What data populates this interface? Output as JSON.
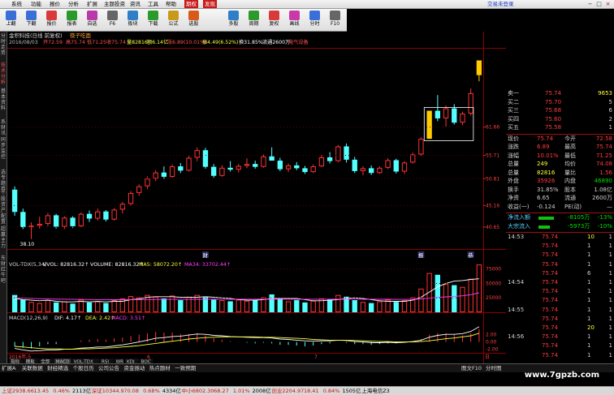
{
  "menubar": {
    "items": [
      "系统",
      "功能",
      "报价",
      "分析",
      "扩展",
      "主题投资",
      "资讯",
      "工具",
      "帮助"
    ],
    "highlight_items": [
      "期权",
      "发现"
    ],
    "login": "交易未登录"
  },
  "toolbar": {
    "buttons": [
      {
        "label": "上翻",
        "icon": "page-up-icon",
        "color": "#3a6fd8"
      },
      {
        "label": "下翻",
        "icon": "page-down-icon",
        "color": "#3a6fd8"
      },
      {
        "label": "报价",
        "icon": "quote-icon",
        "color": "#d83a3a"
      },
      {
        "label": "报表",
        "icon": "report-icon",
        "color": "#2a9a2a"
      },
      {
        "label": "自选",
        "icon": "watchlist-icon",
        "color": "#b83aa8"
      },
      {
        "label": "F6",
        "icon": "f6-icon",
        "color": "#666"
      },
      {
        "label": "板块",
        "icon": "sector-icon",
        "color": "#2f7fc8"
      },
      {
        "label": "下载",
        "icon": "download-icon",
        "color": "#2a9a2a"
      },
      {
        "label": "公式",
        "icon": "formula-icon",
        "color": "#c89a1a"
      },
      {
        "label": "选股",
        "icon": "stock-screen-icon",
        "color": "#d85a1a"
      },
      {
        "label": "多股",
        "icon": "multi-stock-icon",
        "color": "#2f7fc8"
      },
      {
        "label": "周期",
        "icon": "period-icon",
        "color": "#2a9a2a"
      },
      {
        "label": "复权",
        "icon": "adjust-icon",
        "color": "#d83a3a"
      },
      {
        "label": "画线",
        "icon": "draw-line-icon",
        "color": "#c83aa8"
      },
      {
        "label": "分时",
        "icon": "intraday-icon",
        "color": "#3a6fd8"
      },
      {
        "label": "F10",
        "icon": "f10-icon",
        "color": "#666"
      }
    ]
  },
  "left_tabs": [
    "分时走势",
    "技术分析",
    "基本资料",
    "系财讯",
    "同步监控",
    "选专题券",
    "个股资产配置",
    "超赢主力",
    "东财红牛吧"
  ],
  "chart_header": {
    "title": "金积科技(日线 前复权)",
    "pattern": "筷子吃面",
    "date": "2016/08/03",
    "open": "开72.59",
    "high": "高75.74",
    "low": "低71.25",
    "close": "收75.74",
    "volume": "量82816",
    "amount": "额6.14亿",
    "change": "涨6.89(10.01%)",
    "amplitude": "振4.49(6.52%)",
    "turnover": "换31.85%",
    "float": "流通2600万",
    "industry": "电气设备"
  },
  "chart_data": [
    {
      "type": "candlestick",
      "price_axis_ticks": [
        "61.66",
        "55.71",
        "50.81",
        "45.16",
        "40.65"
      ],
      "ylim": [
        36.0,
        78.0
      ],
      "low_marker": "38.10",
      "event_markers": [
        "财",
        "报",
        "恭"
      ],
      "candles": [
        {
          "o": 48.5,
          "h": 49.2,
          "l": 43.0,
          "c": 43.8
        },
        {
          "o": 43.8,
          "h": 44.5,
          "l": 40.2,
          "c": 40.6
        },
        {
          "o": 40.6,
          "h": 41.6,
          "l": 38.1,
          "c": 40.9
        },
        {
          "o": 40.9,
          "h": 42.8,
          "l": 40.3,
          "c": 41.3
        },
        {
          "o": 41.3,
          "h": 43.6,
          "l": 40.8,
          "c": 43.1
        },
        {
          "o": 43.1,
          "h": 43.4,
          "l": 40.3,
          "c": 40.7
        },
        {
          "o": 40.7,
          "h": 42.9,
          "l": 40.2,
          "c": 42.6
        },
        {
          "o": 42.6,
          "h": 42.9,
          "l": 40.4,
          "c": 40.8
        },
        {
          "o": 40.8,
          "h": 43.7,
          "l": 40.6,
          "c": 43.4
        },
        {
          "o": 43.4,
          "h": 44.1,
          "l": 41.7,
          "c": 42.4
        },
        {
          "o": 42.4,
          "h": 44.5,
          "l": 42.0,
          "c": 43.9
        },
        {
          "o": 43.9,
          "h": 44.2,
          "l": 41.8,
          "c": 42.2
        },
        {
          "o": 42.2,
          "h": 44.6,
          "l": 42.0,
          "c": 44.3
        },
        {
          "o": 44.3,
          "h": 45.9,
          "l": 43.5,
          "c": 45.5
        },
        {
          "o": 45.5,
          "h": 48.2,
          "l": 45.1,
          "c": 47.8
        },
        {
          "o": 47.8,
          "h": 49.6,
          "l": 47.2,
          "c": 49.2
        },
        {
          "o": 49.2,
          "h": 51.3,
          "l": 48.6,
          "c": 50.8
        },
        {
          "o": 50.8,
          "h": 52.6,
          "l": 50.3,
          "c": 52.1
        },
        {
          "o": 52.1,
          "h": 53.4,
          "l": 50.7,
          "c": 51.2
        },
        {
          "o": 51.2,
          "h": 53.8,
          "l": 51.0,
          "c": 53.4
        },
        {
          "o": 53.4,
          "h": 54.1,
          "l": 52.0,
          "c": 52.5
        },
        {
          "o": 52.5,
          "h": 55.6,
          "l": 52.3,
          "c": 55.2
        },
        {
          "o": 55.2,
          "h": 57.4,
          "l": 54.5,
          "c": 56.8
        },
        {
          "o": 56.8,
          "h": 57.3,
          "l": 52.9,
          "c": 53.3
        },
        {
          "o": 53.3,
          "h": 53.9,
          "l": 51.0,
          "c": 51.4
        },
        {
          "o": 51.4,
          "h": 53.6,
          "l": 51.2,
          "c": 53.1
        },
        {
          "o": 53.1,
          "h": 54.5,
          "l": 52.3,
          "c": 52.7
        },
        {
          "o": 52.7,
          "h": 53.9,
          "l": 52.1,
          "c": 53.5
        },
        {
          "o": 53.5,
          "h": 55.1,
          "l": 53.0,
          "c": 53.9
        },
        {
          "o": 53.9,
          "h": 54.6,
          "l": 52.9,
          "c": 53.3
        },
        {
          "o": 53.3,
          "h": 55.9,
          "l": 53.1,
          "c": 55.5
        },
        {
          "o": 55.5,
          "h": 57.4,
          "l": 54.8,
          "c": 54.6
        },
        {
          "o": 54.6,
          "h": 55.2,
          "l": 52.4,
          "c": 52.8
        },
        {
          "o": 52.8,
          "h": 54.0,
          "l": 52.2,
          "c": 53.6
        },
        {
          "o": 53.6,
          "h": 54.3,
          "l": 52.6,
          "c": 53.0
        },
        {
          "o": 53.0,
          "h": 53.5,
          "l": 51.8,
          "c": 52.2
        },
        {
          "o": 52.2,
          "h": 53.8,
          "l": 52.0,
          "c": 53.4
        },
        {
          "o": 53.4,
          "h": 55.8,
          "l": 53.2,
          "c": 55.3
        },
        {
          "o": 55.3,
          "h": 56.4,
          "l": 54.0,
          "c": 54.5
        },
        {
          "o": 54.5,
          "h": 57.9,
          "l": 54.3,
          "c": 57.6
        },
        {
          "o": 57.6,
          "h": 58.2,
          "l": 54.2,
          "c": 54.8
        },
        {
          "o": 54.8,
          "h": 55.4,
          "l": 52.0,
          "c": 52.4
        },
        {
          "o": 52.4,
          "h": 53.4,
          "l": 51.5,
          "c": 53.0
        },
        {
          "o": 53.0,
          "h": 53.6,
          "l": 51.6,
          "c": 52.0
        },
        {
          "o": 52.0,
          "h": 53.4,
          "l": 51.8,
          "c": 53.1
        },
        {
          "o": 53.1,
          "h": 55.1,
          "l": 52.8,
          "c": 54.7
        },
        {
          "o": 54.7,
          "h": 55.0,
          "l": 51.9,
          "c": 52.3
        },
        {
          "o": 52.3,
          "h": 54.5,
          "l": 51.8,
          "c": 54.2
        },
        {
          "o": 54.2,
          "h": 56.3,
          "l": 54.0,
          "c": 55.9
        },
        {
          "o": 55.9,
          "h": 59.5,
          "l": 55.6,
          "c": 59.2
        },
        {
          "o": 59.2,
          "h": 65.1,
          "l": 59.2,
          "c": 65.1
        },
        {
          "o": 65.1,
          "h": 68.4,
          "l": 62.9,
          "c": 63.5
        },
        {
          "o": 63.5,
          "h": 66.2,
          "l": 61.8,
          "c": 65.6
        },
        {
          "o": 65.6,
          "h": 66.5,
          "l": 62.2,
          "c": 62.6
        },
        {
          "o": 62.6,
          "h": 64.9,
          "l": 62.1,
          "c": 64.5
        },
        {
          "o": 64.5,
          "h": 69.8,
          "l": 64.1,
          "c": 68.8
        },
        {
          "o": 72.6,
          "h": 75.7,
          "l": 71.3,
          "c": 75.7
        }
      ]
    },
    {
      "type": "bar",
      "name": "VOL-TDX(5,34)",
      "legend": [
        "VOL-TDX(5,34)",
        "VVOL: 82816.32↑",
        "VOLUME: 82816.32↑",
        "MA5: 58072.20↑",
        "MA34: 33702.44↑"
      ],
      "axis_ticks": [
        "75000",
        "50000",
        "25000"
      ],
      "ylim": [
        0,
        90000
      ],
      "values": [
        30000,
        22000,
        18000,
        16000,
        21000,
        17000,
        19000,
        15000,
        22000,
        17000,
        19000,
        16000,
        21000,
        24000,
        28000,
        26000,
        30000,
        27000,
        24000,
        29000,
        21000,
        27000,
        30000,
        26000,
        22000,
        21000,
        19000,
        22000,
        20000,
        21000,
        26000,
        31000,
        24000,
        19000,
        21000,
        17000,
        20000,
        24000,
        22000,
        30000,
        27000,
        21000,
        18000,
        16000,
        19000,
        22000,
        18000,
        21000,
        26000,
        41000,
        68000,
        65000,
        49000,
        47000,
        44000,
        58000,
        82816
      ],
      "ma5": [
        24000,
        22000,
        21000,
        20000,
        21000,
        19000,
        18000,
        18000,
        19000,
        18000,
        19000,
        18000,
        19000,
        19000,
        22000,
        23000,
        26000,
        27000,
        27000,
        27000,
        26000,
        26000,
        26000,
        27000,
        26000,
        25000,
        24000,
        22000,
        21000,
        21000,
        22000,
        24000,
        24000,
        24000,
        24000,
        22000,
        20000,
        20000,
        21000,
        22000,
        24000,
        25000,
        24000,
        22000,
        20000,
        19000,
        19000,
        19000,
        21000,
        26000,
        35000,
        44000,
        50000,
        54000,
        55000,
        57000,
        58072
      ],
      "ma34": [
        25000,
        24500,
        24000,
        23500,
        23000,
        22800,
        22600,
        22400,
        22300,
        22100,
        22000,
        21900,
        21800,
        21800,
        21900,
        22000,
        22100,
        22200,
        22300,
        22300,
        22300,
        22400,
        22500,
        22600,
        22600,
        22600,
        22600,
        22600,
        22600,
        22600,
        22700,
        22800,
        22800,
        22800,
        22700,
        22600,
        22600,
        22600,
        22600,
        22700,
        22800,
        22800,
        22700,
        22600,
        22500,
        22500,
        22400,
        22400,
        22500,
        23200,
        24500,
        25800,
        26700,
        27500,
        28500,
        30500,
        33702
      ]
    },
    {
      "type": "line",
      "name": "MACD(12,26,9)",
      "legend": [
        "MACD(12,26,9)",
        "DIF: 4.17↑",
        "DEA: 2.42↑",
        "MACD: 3.51↑"
      ],
      "axis_ticks": [
        "2.00",
        "0.00",
        "-2.00"
      ],
      "ylim": [
        -3.0,
        5.5
      ],
      "dif": [
        -1.8,
        -2.2,
        -2.5,
        -2.4,
        -2.2,
        -2.2,
        -2.0,
        -2.0,
        -1.7,
        -1.6,
        -1.4,
        -1.4,
        -1.1,
        -0.8,
        -0.4,
        0.0,
        0.5,
        1.0,
        1.2,
        1.5,
        1.6,
        1.9,
        2.2,
        2.1,
        1.8,
        1.7,
        1.5,
        1.4,
        1.3,
        1.2,
        1.2,
        1.1,
        0.8,
        0.7,
        0.5,
        0.3,
        0.2,
        0.3,
        0.3,
        0.5,
        0.4,
        0.1,
        0.0,
        -0.2,
        -0.2,
        -0.1,
        -0.2,
        -0.1,
        0.1,
        0.5,
        1.3,
        1.8,
        2.1,
        2.1,
        2.3,
        2.9,
        4.17
      ],
      "dea": [
        -1.2,
        -1.4,
        -1.6,
        -1.8,
        -1.9,
        -1.9,
        -2.0,
        -2.0,
        -1.9,
        -1.9,
        -1.8,
        -1.7,
        -1.6,
        -1.4,
        -1.2,
        -1.0,
        -0.7,
        -0.4,
        -0.1,
        0.2,
        0.5,
        0.8,
        1.0,
        1.2,
        1.3,
        1.4,
        1.4,
        1.4,
        1.4,
        1.4,
        1.3,
        1.3,
        1.2,
        1.1,
        1.0,
        0.9,
        0.7,
        0.6,
        0.5,
        0.5,
        0.5,
        0.4,
        0.3,
        0.2,
        0.1,
        0.1,
        0.0,
        0.0,
        0.0,
        0.1,
        0.3,
        0.6,
        0.9,
        1.1,
        1.4,
        1.7,
        2.42
      ],
      "hist": [
        -1.2,
        -1.6,
        -1.8,
        -1.2,
        -0.6,
        -0.6,
        0.0,
        0.0,
        0.4,
        0.6,
        0.8,
        0.6,
        1.0,
        1.2,
        1.6,
        2.0,
        2.4,
        2.8,
        2.6,
        2.6,
        2.2,
        2.2,
        2.4,
        1.8,
        1.0,
        0.6,
        0.2,
        0.0,
        -0.2,
        -0.4,
        -0.2,
        -0.4,
        -0.8,
        -0.8,
        -1.0,
        -1.2,
        -1.0,
        -0.6,
        -0.4,
        0.0,
        -0.2,
        -0.6,
        -0.6,
        -0.8,
        -0.6,
        -0.4,
        -0.4,
        -0.2,
        0.2,
        0.8,
        2.0,
        2.4,
        2.4,
        2.0,
        1.8,
        2.4,
        3.51
      ]
    }
  ],
  "x_axis_labels": [
    "2016年-5",
    "6",
    "7",
    "日"
  ],
  "indicator_tabs": [
    "指标",
    "模板",
    "全部",
    "MACD",
    "VOL-TDX",
    "RSI",
    "WR",
    "KDJ",
    "BOC"
  ],
  "quote_panel": {
    "sell_book": [
      {
        "label": "卖一",
        "price": "75.74",
        "vol": "9653"
      },
      {
        "label": "买二",
        "price": "75.70",
        "vol": "5"
      },
      {
        "label": "买三",
        "price": "75.68",
        "vol": "6"
      },
      {
        "label": "买四",
        "price": "75.60",
        "vol": "2"
      },
      {
        "label": "买五",
        "price": "75.58",
        "vol": "1"
      }
    ],
    "stats": [
      {
        "l1": "现价",
        "v1": "75.74",
        "l2": "今开",
        "v2": "72.58",
        "c1": "red",
        "c2": "red"
      },
      {
        "l1": "涨跌",
        "v1": "6.89",
        "l2": "最高",
        "v2": "75.74",
        "c1": "red",
        "c2": "red"
      },
      {
        "l1": "涨幅",
        "v1": "10.01%",
        "l2": "最低",
        "v2": "71.25",
        "c1": "red",
        "c2": "red"
      },
      {
        "l1": "总量",
        "v1": "249",
        "l2": "均价",
        "v2": "74.08",
        "c1": "yel",
        "c2": "red"
      },
      {
        "l1": "总量",
        "v1": "82816",
        "l2": "量比",
        "v2": "1.56",
        "c1": "yel",
        "c2": "red"
      },
      {
        "l1": "外盘",
        "v1": "35926",
        "l2": "内盘",
        "v2": "46890",
        "c1": "red",
        "c2": "green"
      },
      {
        "l1": "换手",
        "v1": "31.85%",
        "l2": "股本",
        "v2": "1.08亿",
        "c1": "grey",
        "c2": "grey"
      },
      {
        "l1": "净资",
        "v1": "6.65",
        "l2": "流通",
        "v2": "2600万",
        "c1": "grey",
        "c2": "grey"
      },
      {
        "l1": "收益(一)",
        "v1": "-0.124",
        "l2": "PE(动)",
        "v2": "—",
        "c1": "grey",
        "c2": "grey"
      }
    ],
    "flows": [
      {
        "label": "净流入额",
        "value": "-8105万",
        "pct": "-13%",
        "bar": 0.62
      },
      {
        "label": "大宗流入",
        "value": "-5973万",
        "pct": "-10%",
        "bar": 0.48
      }
    ],
    "ticks": [
      {
        "time": "14:53",
        "price": "75.74",
        "vol": "10",
        "n": "1"
      },
      {
        "time": "",
        "price": "75.74",
        "vol": "1",
        "n": "1"
      },
      {
        "time": "",
        "price": "75.74",
        "vol": "1",
        "n": "1"
      },
      {
        "time": "",
        "price": "75.74",
        "vol": "1",
        "n": "1"
      },
      {
        "time": "",
        "price": "75.74",
        "vol": "6",
        "n": "1"
      },
      {
        "time": "14:54",
        "price": "75.74",
        "vol": "1",
        "n": "1"
      },
      {
        "time": "",
        "price": "75.74",
        "vol": "1",
        "n": "1"
      },
      {
        "time": "",
        "price": "75.74",
        "vol": "1",
        "n": "1"
      },
      {
        "time": "14:55",
        "price": "75.74",
        "vol": "1",
        "n": "1"
      },
      {
        "time": "",
        "price": "75.74",
        "vol": "1",
        "n": "1"
      },
      {
        "time": "",
        "price": "75.74",
        "vol": "20",
        "n": "1"
      },
      {
        "time": "14:56",
        "price": "75.74",
        "vol": "1",
        "n": "1"
      },
      {
        "time": "",
        "price": "75.74",
        "vol": "1",
        "n": "1"
      },
      {
        "time": "",
        "price": "75.74",
        "vol": "1",
        "n": "1"
      }
    ]
  },
  "bottom_tabs": [
    "扩展A",
    "关联数据",
    "财经精选",
    "个股日历",
    "公司公告",
    "资金振动",
    "热点题材",
    "一致预期"
  ],
  "bottom_right": [
    "图文F10",
    "分时图"
  ],
  "watermark": "www.7gpzb.com",
  "status_bar": [
    {
      "text": "上证2938.66",
      "c": "red"
    },
    {
      "text": "13.45",
      "c": "red"
    },
    {
      "text": "0.46%",
      "c": "red"
    },
    {
      "text": "2113亿",
      "c": "k"
    },
    {
      "text": "深证10344.9",
      "c": "red"
    },
    {
      "text": "70.08",
      "c": "red"
    },
    {
      "text": "0.68%",
      "c": "red"
    },
    {
      "text": "4334亿",
      "c": "k"
    },
    {
      "text": "中小6802.30",
      "c": "red"
    },
    {
      "text": "68.27",
      "c": "red"
    },
    {
      "text": "1.01%",
      "c": "red"
    },
    {
      "text": "2008亿",
      "c": "k"
    },
    {
      "text": "创业2204.97",
      "c": "red"
    },
    {
      "text": "18.41",
      "c": "red"
    },
    {
      "text": "0.84%",
      "c": "red"
    },
    {
      "text": "1505亿",
      "c": "k"
    },
    {
      "text": "上海电信Z3",
      "c": "k"
    }
  ],
  "colors": {
    "up": "#ff3333",
    "down": "#54ffff",
    "limit": "#ffcc00",
    "ma5": "#ffffff",
    "ma34": "#ff40ff",
    "grid": "#8b0000"
  }
}
